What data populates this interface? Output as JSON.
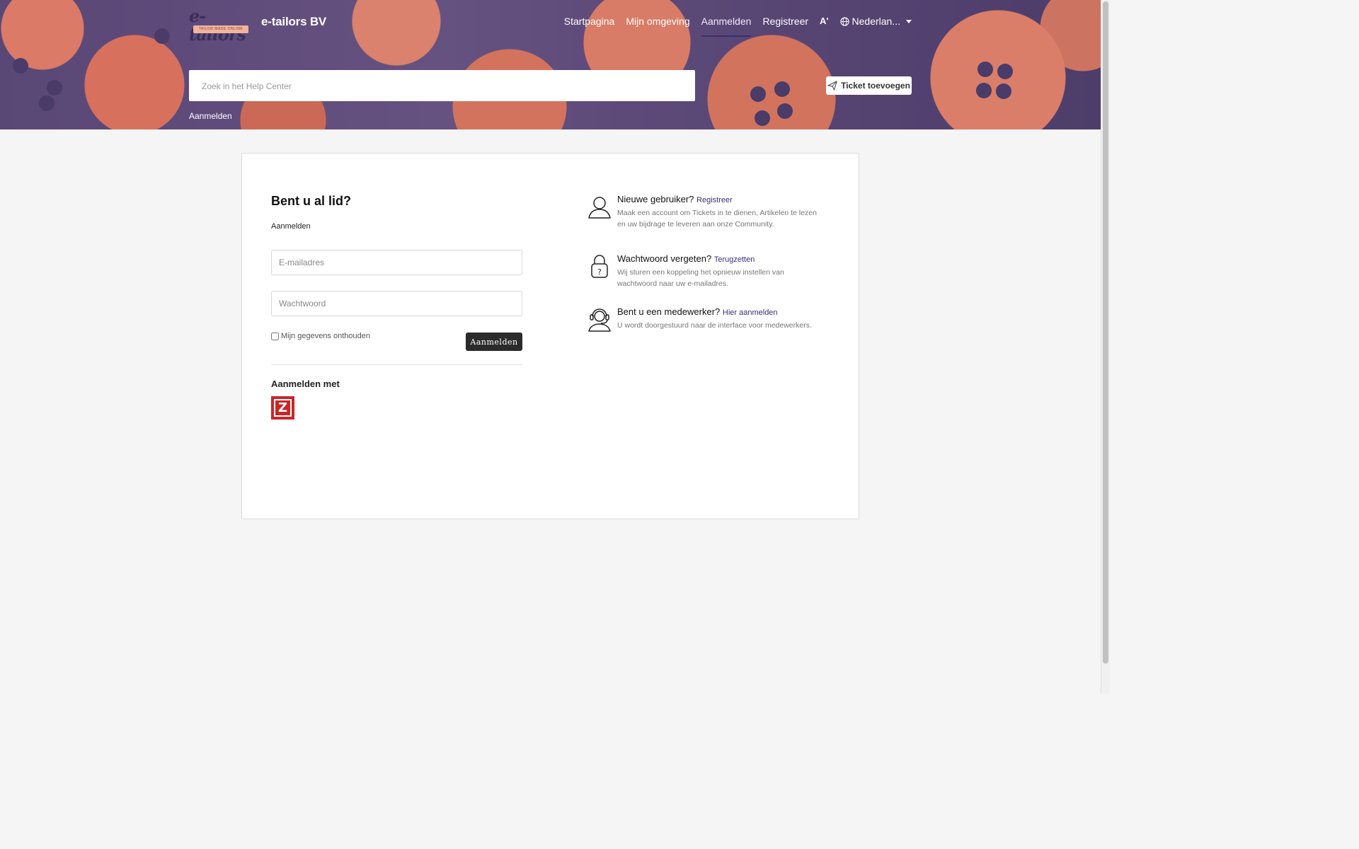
{
  "colors": {
    "accent": "#3b2f6b",
    "hero": "#e4785f",
    "login_button": "#2b2b2b",
    "zendesk": "#c9262b"
  },
  "header": {
    "logo_text": "e-tailors",
    "logo_tagline": "TAILOR MADE ONLINE",
    "brand_name": "e-tailors BV",
    "nav": [
      {
        "label": "Startpagina"
      },
      {
        "label": "Mijn omgeving"
      },
      {
        "label": "Aanmelden"
      },
      {
        "label": "Registreer"
      }
    ],
    "accessibility_label": "A'",
    "language": "Nederlan..."
  },
  "search": {
    "placeholder": "Zoek in het Help Center"
  },
  "ticket_button": {
    "label": "Ticket toevoegen",
    "icon": "paper-plane-icon"
  },
  "breadcrumb": "Aanmelden",
  "login": {
    "heading": "Bent u al lid?",
    "subheading": "Aanmelden",
    "email_placeholder": "E-mailadres",
    "password_placeholder": "Wachtwoord",
    "remember_label": "Mijn gegevens onthouden",
    "submit_label": "Aanmelden",
    "sso_heading": "Aanmelden met",
    "sso_provider": "Z"
  },
  "info": [
    {
      "icon": "user-icon",
      "title": "Nieuwe gebruiker?",
      "link": "Registreer",
      "desc": "Maak een account om Tickets in te dienen, Artikelen te lezen en uw bijdrage te leveren aan onze Community."
    },
    {
      "icon": "lock-question-icon",
      "title": "Wachtwoord vergeten?",
      "link": "Terugzetten",
      "desc": "Wij sturen een koppeling het opnieuw instellen van wachtwoord naar uw e-mailadres."
    },
    {
      "icon": "headset-icon",
      "title": "Bent u een medewerker?",
      "link": "Hier aanmelden",
      "desc": "U wordt doorgestuurd naar de interface voor medewerkers."
    }
  ]
}
